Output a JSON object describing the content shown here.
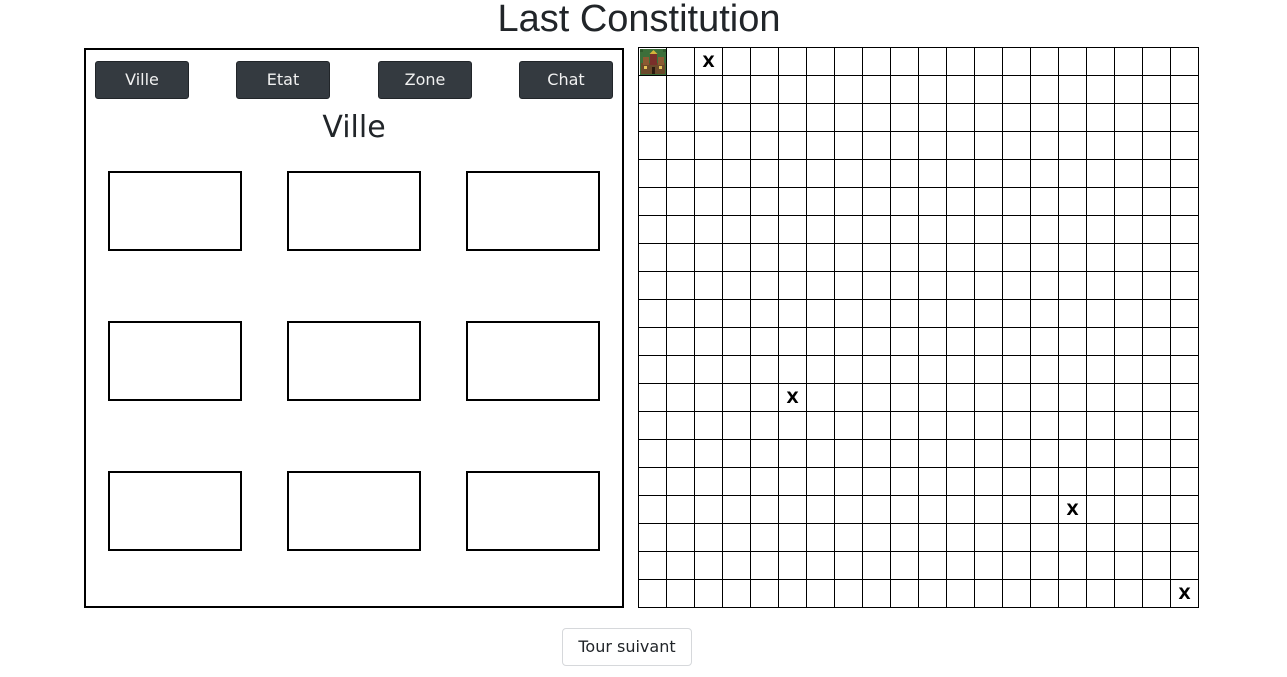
{
  "app": {
    "title": "Last Constitution"
  },
  "panel": {
    "tabs": [
      {
        "label": "Ville"
      },
      {
        "label": "Etat"
      },
      {
        "label": "Zone"
      },
      {
        "label": "Chat"
      }
    ],
    "section_title": "Ville",
    "slots_count": 9
  },
  "map": {
    "rows": 20,
    "cols": 20,
    "city_cell": {
      "row": 0,
      "col": 0,
      "icon": "city-icon"
    },
    "marker_symbol": "X",
    "markers": [
      {
        "row": 0,
        "col": 2
      },
      {
        "row": 12,
        "col": 5
      },
      {
        "row": 16,
        "col": 15
      },
      {
        "row": 19,
        "col": 19
      }
    ]
  },
  "footer": {
    "next_turn_label": "Tour suivant"
  }
}
